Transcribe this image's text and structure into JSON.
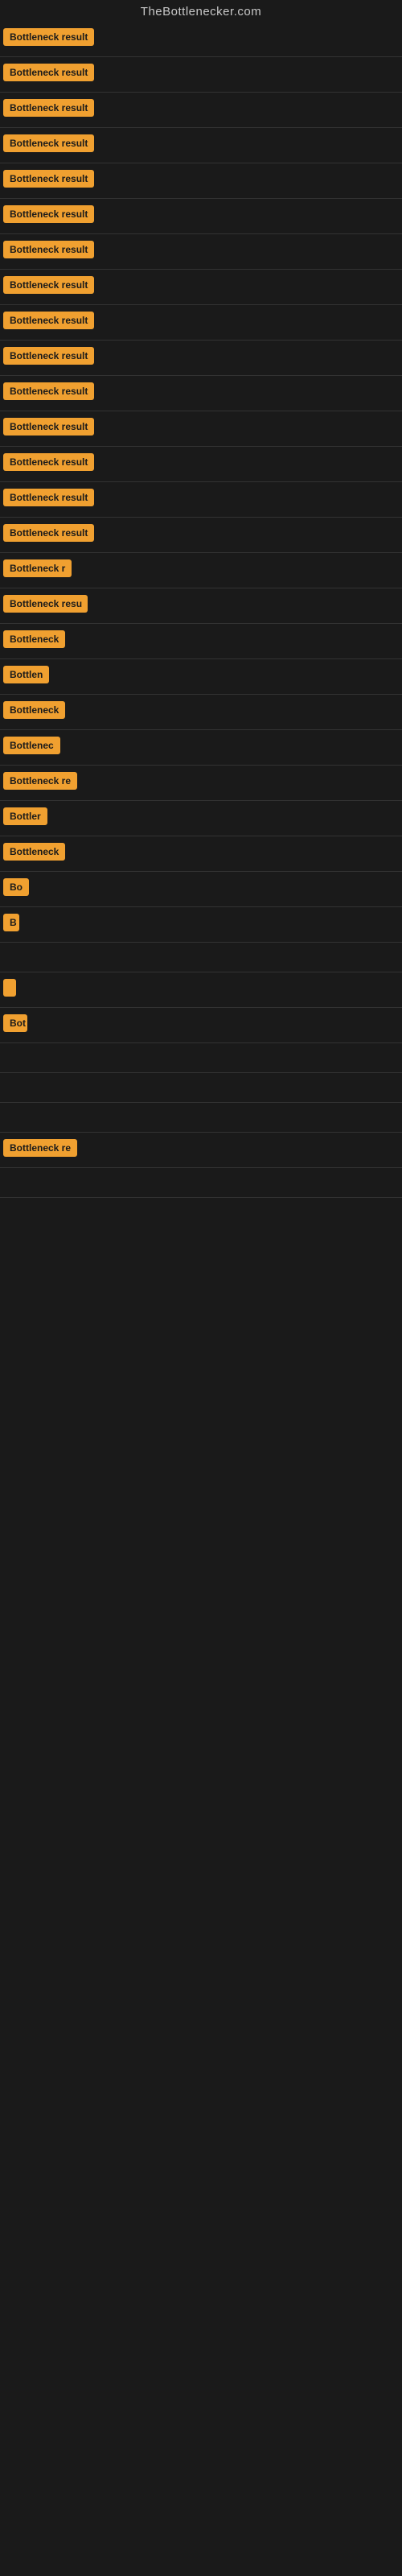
{
  "site": {
    "title": "TheBottlenecker.com"
  },
  "badge_label": "Bottleneck result",
  "rows": [
    {
      "id": 1,
      "label": "Bottleneck result",
      "width": 120
    },
    {
      "id": 2,
      "label": "Bottleneck result",
      "width": 120
    },
    {
      "id": 3,
      "label": "Bottleneck result",
      "width": 120
    },
    {
      "id": 4,
      "label": "Bottleneck result",
      "width": 120
    },
    {
      "id": 5,
      "label": "Bottleneck result",
      "width": 120
    },
    {
      "id": 6,
      "label": "Bottleneck result",
      "width": 120
    },
    {
      "id": 7,
      "label": "Bottleneck result",
      "width": 120
    },
    {
      "id": 8,
      "label": "Bottleneck result",
      "width": 120
    },
    {
      "id": 9,
      "label": "Bottleneck result",
      "width": 120
    },
    {
      "id": 10,
      "label": "Bottleneck result",
      "width": 120
    },
    {
      "id": 11,
      "label": "Bottleneck result",
      "width": 120
    },
    {
      "id": 12,
      "label": "Bottleneck result",
      "width": 120
    },
    {
      "id": 13,
      "label": "Bottleneck result",
      "width": 120
    },
    {
      "id": 14,
      "label": "Bottleneck result",
      "width": 120
    },
    {
      "id": 15,
      "label": "Bottleneck result",
      "width": 115
    },
    {
      "id": 16,
      "label": "Bottleneck r",
      "width": 85
    },
    {
      "id": 17,
      "label": "Bottleneck resu",
      "width": 100
    },
    {
      "id": 18,
      "label": "Bottleneck",
      "width": 72
    },
    {
      "id": 19,
      "label": "Bottlen",
      "width": 60
    },
    {
      "id": 20,
      "label": "Bottleneck",
      "width": 72
    },
    {
      "id": 21,
      "label": "Bottlenec",
      "width": 68
    },
    {
      "id": 22,
      "label": "Bottleneck re",
      "width": 95
    },
    {
      "id": 23,
      "label": "Bottler",
      "width": 55
    },
    {
      "id": 24,
      "label": "Bottleneck",
      "width": 72
    },
    {
      "id": 25,
      "label": "Bo",
      "width": 30
    },
    {
      "id": 26,
      "label": "B",
      "width": 16
    },
    {
      "id": 27,
      "label": "",
      "width": 0
    },
    {
      "id": 28,
      "label": "",
      "width": 2
    },
    {
      "id": 29,
      "label": "Bot",
      "width": 28
    },
    {
      "id": 30,
      "label": "",
      "width": 0
    },
    {
      "id": 31,
      "label": "",
      "width": 0
    },
    {
      "id": 32,
      "label": "",
      "width": 0
    },
    {
      "id": 33,
      "label": "Bottleneck re",
      "width": 95
    },
    {
      "id": 34,
      "label": "",
      "width": 0
    },
    {
      "id": 35,
      "label": "",
      "width": 0
    }
  ]
}
